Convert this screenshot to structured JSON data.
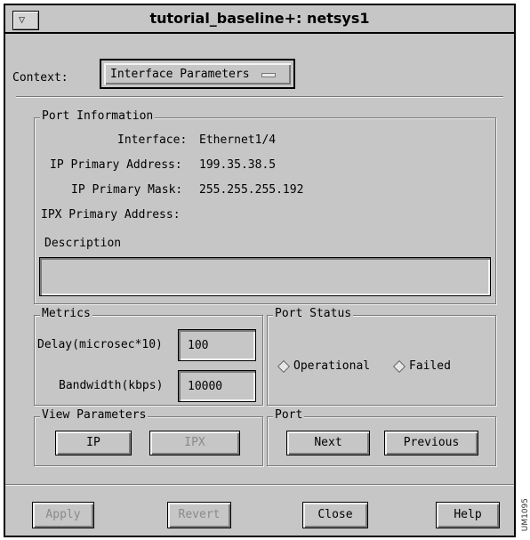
{
  "window": {
    "title": "tutorial_baseline+: netsys1",
    "menu_glyph": "▽"
  },
  "context": {
    "label": "Context:",
    "selected": "Interface Parameters"
  },
  "port_information": {
    "legend": "Port Information",
    "interface_label": "Interface:",
    "interface_value": "Ethernet1/4",
    "ip_address_label": "IP Primary Address:",
    "ip_address_value": "199.35.38.5",
    "ip_mask_label": "IP Primary Mask:",
    "ip_mask_value": "255.255.255.192",
    "ipx_address_label": "IPX Primary Address:",
    "description_label": "Description",
    "description_value": ""
  },
  "metrics": {
    "legend": "Metrics",
    "delay_label": "Delay(microsec*10)",
    "delay_value": "100",
    "bandwidth_label": "Bandwidth(kbps)",
    "bandwidth_value": "10000"
  },
  "port_status": {
    "legend": "Port Status",
    "operational_label": "Operational",
    "failed_label": "Failed"
  },
  "view_parameters": {
    "legend": "View Parameters",
    "ip_label": "IP",
    "ipx_label": "IPX"
  },
  "port": {
    "legend": "Port",
    "next_label": "Next",
    "previous_label": "Previous"
  },
  "footer": {
    "apply_label": "Apply",
    "revert_label": "Revert",
    "close_label": "Close",
    "help_label": "Help"
  },
  "side_tag": "UM1095"
}
